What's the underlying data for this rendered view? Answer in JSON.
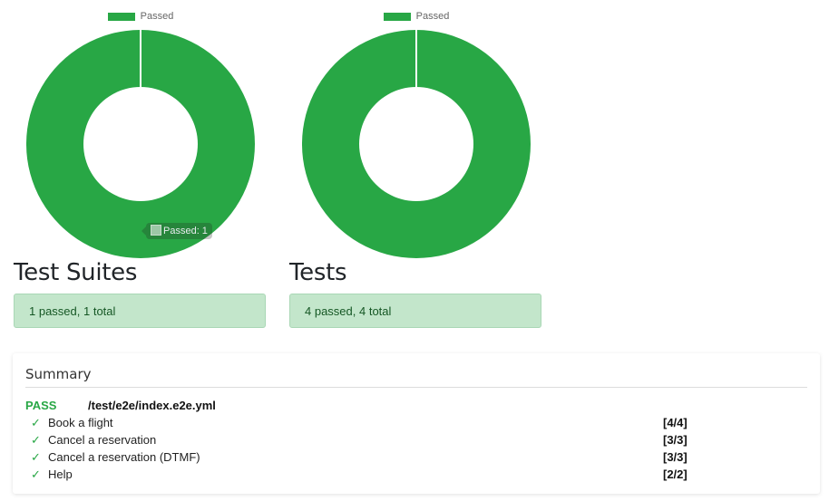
{
  "colors": {
    "passed": "#28a745",
    "passed_status_bg": "#c3e6cb",
    "passed_status_text": "#155724"
  },
  "charts": [
    {
      "legend_label": "Passed",
      "title": "Test Suites",
      "status_text": "1 passed, 1 total",
      "tooltip": "Passed: 1",
      "chart_data": {
        "type": "pie",
        "categories": [
          "Passed"
        ],
        "values": [
          1
        ],
        "title": "",
        "legend_position": "top"
      }
    },
    {
      "legend_label": "Passed",
      "title": "Tests",
      "status_text": "4 passed, 4 total",
      "chart_data": {
        "type": "pie",
        "categories": [
          "Passed"
        ],
        "values": [
          4
        ],
        "title": "",
        "legend_position": "top"
      }
    }
  ],
  "summary": {
    "title": "Summary",
    "suite": {
      "status": "PASS",
      "path": "/test/e2e/index.e2e.yml"
    },
    "tests": [
      {
        "icon": "checkmark-icon",
        "check": "✓",
        "name": "Book a flight",
        "count": "[4/4]"
      },
      {
        "icon": "checkmark-icon",
        "check": "✓",
        "name": "Cancel a reservation",
        "count": "[3/3]"
      },
      {
        "icon": "checkmark-icon",
        "check": "✓",
        "name": "Cancel a reservation (DTMF)",
        "count": "[3/3]"
      },
      {
        "icon": "checkmark-icon",
        "check": "✓",
        "name": "Help",
        "count": "[2/2]"
      }
    ]
  }
}
